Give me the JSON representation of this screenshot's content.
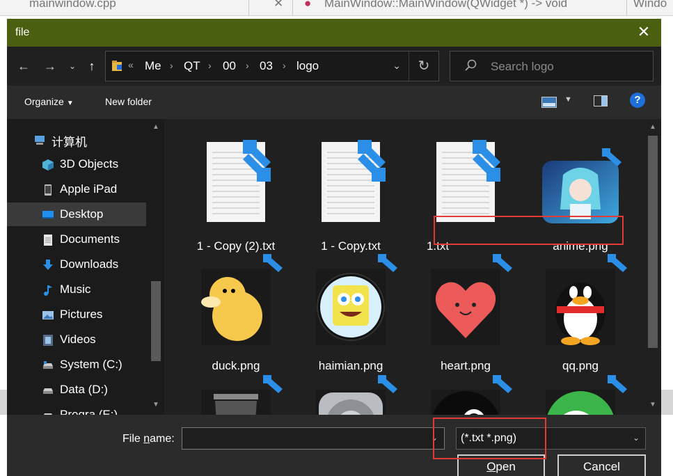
{
  "background": {
    "tabs": [
      {
        "label": "mainwindow.cpp"
      },
      {
        "label": "MainWindow::MainWindow(QWidget *) -> void"
      },
      {
        "label": "Windo"
      }
    ]
  },
  "dialog": {
    "title": "file",
    "close_icon": "close-icon",
    "colors": {
      "titlebar": "#4b5f10",
      "highlight": "#e53935",
      "accent": "#1e6fd9"
    }
  },
  "nav": {
    "breadcrumb_overflow": "«",
    "breadcrumb": [
      {
        "label": "Me"
      },
      {
        "label": "QT"
      },
      {
        "label": "00"
      },
      {
        "label": "03"
      },
      {
        "label": "logo"
      }
    ],
    "search_placeholder": "Search logo"
  },
  "toolbar": {
    "organize_label": "Organize",
    "new_folder_label": "New folder",
    "help_label": "?"
  },
  "sidebar": {
    "items": [
      {
        "label": "计算机",
        "icon": "computer-icon"
      },
      {
        "label": "3D Objects",
        "icon": "cube-icon"
      },
      {
        "label": "Apple iPad",
        "icon": "device-icon"
      },
      {
        "label": "Desktop",
        "icon": "desktop-icon",
        "selected": true
      },
      {
        "label": "Documents",
        "icon": "document-icon"
      },
      {
        "label": "Downloads",
        "icon": "download-icon"
      },
      {
        "label": "Music",
        "icon": "music-icon"
      },
      {
        "label": "Pictures",
        "icon": "picture-icon"
      },
      {
        "label": "Videos",
        "icon": "video-icon"
      },
      {
        "label": "System (C:)",
        "icon": "drive-icon"
      },
      {
        "label": "Data (D:)",
        "icon": "drive-icon"
      },
      {
        "label": "Progra (E:)",
        "icon": "drive-icon"
      }
    ]
  },
  "files": {
    "items": [
      {
        "label": "1 - Copy (2).txt",
        "type": "txt"
      },
      {
        "label": "1 - Copy.txt",
        "type": "txt"
      },
      {
        "label": "1.txt",
        "type": "txt"
      },
      {
        "label": "anime.png",
        "type": "anime"
      },
      {
        "label": "duck.png",
        "type": "duck"
      },
      {
        "label": "haimian.png",
        "type": "sponge"
      },
      {
        "label": "heart.png",
        "type": "heart"
      },
      {
        "label": "qq.png",
        "type": "qq"
      },
      {
        "label": "",
        "type": "trash"
      },
      {
        "label": "",
        "type": "settings"
      },
      {
        "label": "",
        "type": "steam"
      },
      {
        "label": "",
        "type": "wechat"
      }
    ]
  },
  "bottom": {
    "file_name_label_pre": "File ",
    "file_name_label_u": "n",
    "file_name_label_post": "ame:",
    "file_name_value": "",
    "filter_value": "(*.txt *.png)",
    "open_label_u": "O",
    "open_label_post": "pen",
    "cancel_label": "Cancel"
  }
}
